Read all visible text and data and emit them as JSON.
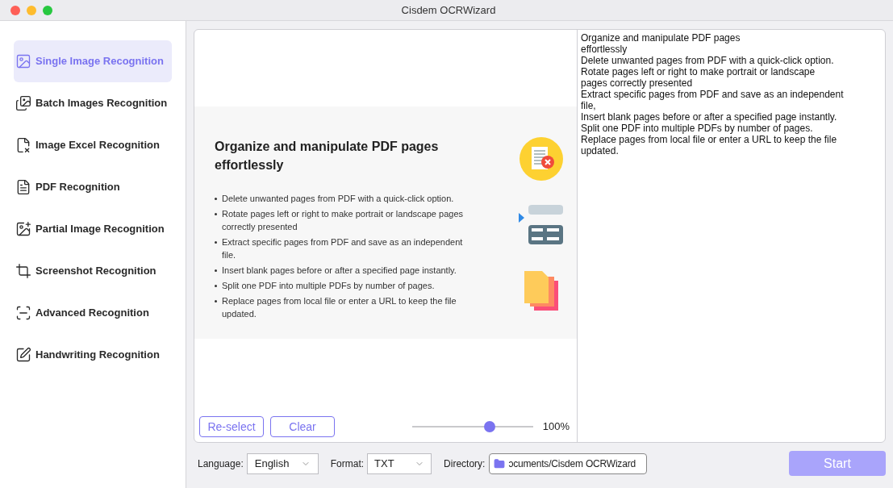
{
  "window": {
    "title": "Cisdem OCRWizard"
  },
  "sidebar": {
    "items": [
      {
        "label": "Single Image Recognition",
        "kind": "image",
        "selected": true
      },
      {
        "label": "Batch Images Recognition",
        "kind": "images",
        "selected": false
      },
      {
        "label": "Image Excel Recognition",
        "kind": "excel",
        "selected": false
      },
      {
        "label": "PDF Recognition",
        "kind": "pdf",
        "selected": false
      },
      {
        "label": "Partial Image Recognition",
        "kind": "partial",
        "selected": false
      },
      {
        "label": "Screenshot Recognition",
        "kind": "crop",
        "selected": false
      },
      {
        "label": "Advanced Recognition",
        "kind": "scan",
        "selected": false
      },
      {
        "label": "Handwriting Recognition",
        "kind": "handwriting",
        "selected": false
      }
    ]
  },
  "preview": {
    "image": {
      "heading": "Organize and manipulate PDF pages effortlessly",
      "bullets": [
        "Delete unwanted pages from PDF with a quick-click option.",
        "Rotate pages left or right to make portrait or landscape pages correctly presented",
        "Extract specific pages from PDF and save as an independent file.",
        "Insert blank pages before or after a specified page instantly.",
        "Split one PDF into multiple PDFs by number of pages.",
        "Replace pages from local file or enter a URL to keep the file updated."
      ]
    },
    "buttons": [
      "Re-select",
      "Clear"
    ],
    "zoom": {
      "level": 0.64,
      "reading": "100%"
    }
  },
  "result": {
    "lines": [
      "Organize and manipulate PDF pages",
      "effortlessly",
      "Delete unwanted pages from PDF with a quick-click option.",
      "Rotate pages left or right to make portrait or landscape",
      "pages correctly presented",
      "Extract specific pages from PDF and save as an independent",
      "file,",
      "Insert blank pages before or after a specified page instantly.",
      "Split one PDF into multiple PDFs by number of pages.",
      "Replace pages from local file or enter a URL to keep the file",
      "updated."
    ]
  },
  "bottom_bar": {
    "language": {
      "label": "Language:",
      "value": "English"
    },
    "format": {
      "label": "Format:",
      "value": "TXT"
    },
    "directory": {
      "label": "Directory:",
      "value": "ɔcuments/Cisdem OCRWizard"
    },
    "start": "Start"
  }
}
